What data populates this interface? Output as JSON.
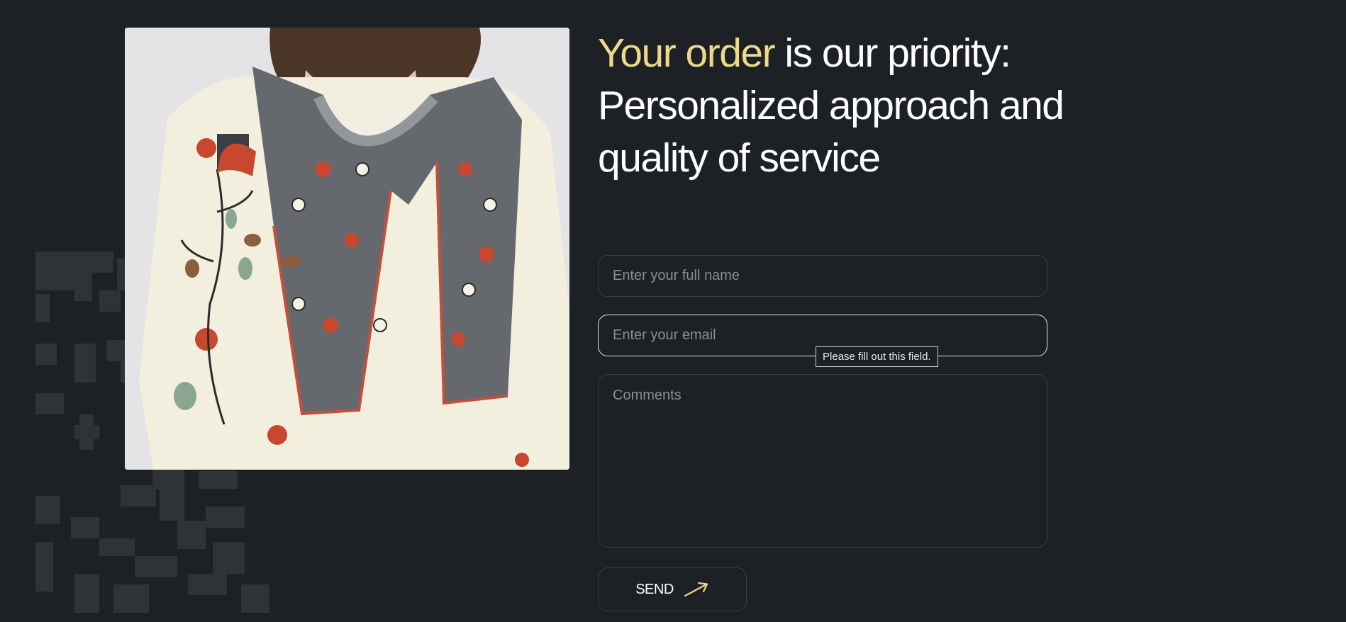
{
  "headline": {
    "accent": "Your order",
    "rest_line1": " is our priority:",
    "line2": "Personalized approach and",
    "line3": "quality of service"
  },
  "form": {
    "name_placeholder": "Enter your full name",
    "email_placeholder": "Enter your email",
    "comments_placeholder": "Comments",
    "validation_tooltip": "Please fill out this field.",
    "send_label": "SEND"
  },
  "colors": {
    "background": "#1d2024",
    "accent": "#ecd98a",
    "text": "#ffffff",
    "border": "#3a3e43"
  },
  "icons": {
    "send": "arrow-up-right-icon"
  }
}
